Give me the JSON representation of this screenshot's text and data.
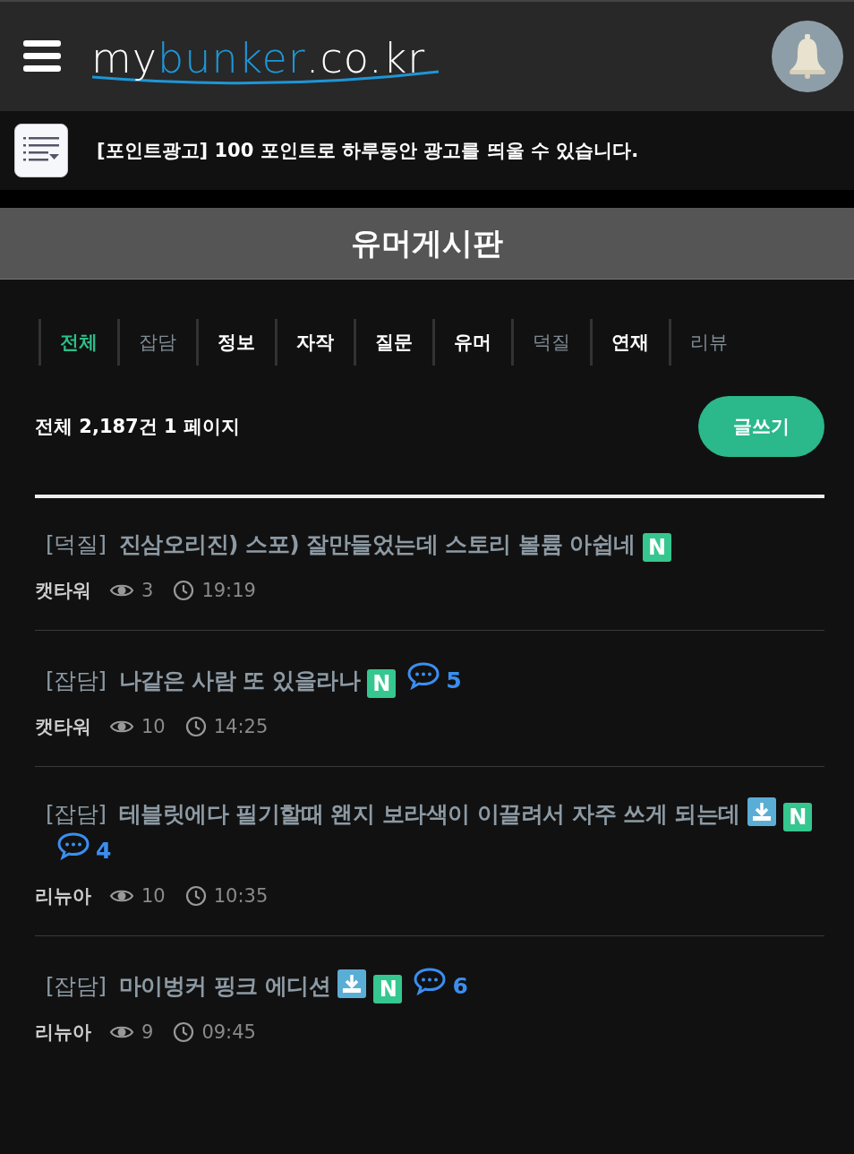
{
  "header": {
    "logo": {
      "part_1": "my",
      "part_2": "bunker",
      "part_3": ".co.kr"
    }
  },
  "notice": {
    "text": "[포인트광고] 100 포인트로 하루동안 광고를 띄울 수 있습니다."
  },
  "board": {
    "title": "유머게시판"
  },
  "tabs": [
    {
      "label": "전체",
      "selected": true,
      "dimmed": false
    },
    {
      "label": "잡담",
      "selected": false,
      "dimmed": true
    },
    {
      "label": "정보",
      "selected": false,
      "dimmed": false
    },
    {
      "label": "자작",
      "selected": false,
      "dimmed": false
    },
    {
      "label": "질문",
      "selected": false,
      "dimmed": false
    },
    {
      "label": "유머",
      "selected": false,
      "dimmed": false
    },
    {
      "label": "덕질",
      "selected": false,
      "dimmed": true
    },
    {
      "label": "연재",
      "selected": false,
      "dimmed": false
    },
    {
      "label": "리뷰",
      "selected": false,
      "dimmed": true
    }
  ],
  "summary": "전체 2,187건 1 페이지",
  "write_button": "글쓰기",
  "posts": [
    {
      "category": "[덕질]",
      "title": "진삼오리진) 스포) 잘만들었는데 스토리 볼륨 아쉽네",
      "attachment": false,
      "new_badge": "N",
      "author": "캣타워",
      "views": "3",
      "time": "19:19"
    },
    {
      "category": "[잡담]",
      "title": "나같은 사람 또 있을라나",
      "attachment": false,
      "new_badge": "N",
      "comments": "5",
      "author": "캣타워",
      "views": "10",
      "time": "14:25"
    },
    {
      "category": "[잡담]",
      "title": "테블릿에다 필기할때 왠지 보라색이 이끌려서 자주 쓰게 되는데",
      "attachment": true,
      "new_badge": "N",
      "comments": "4",
      "author": "리뉴아",
      "views": "10",
      "time": "10:35"
    },
    {
      "category": "[잡담]",
      "title": "마이벙커 핑크 에디션",
      "attachment": true,
      "new_badge": "N",
      "comments": "6",
      "author": "리뉴아",
      "views": "9",
      "time": "09:45"
    }
  ]
}
